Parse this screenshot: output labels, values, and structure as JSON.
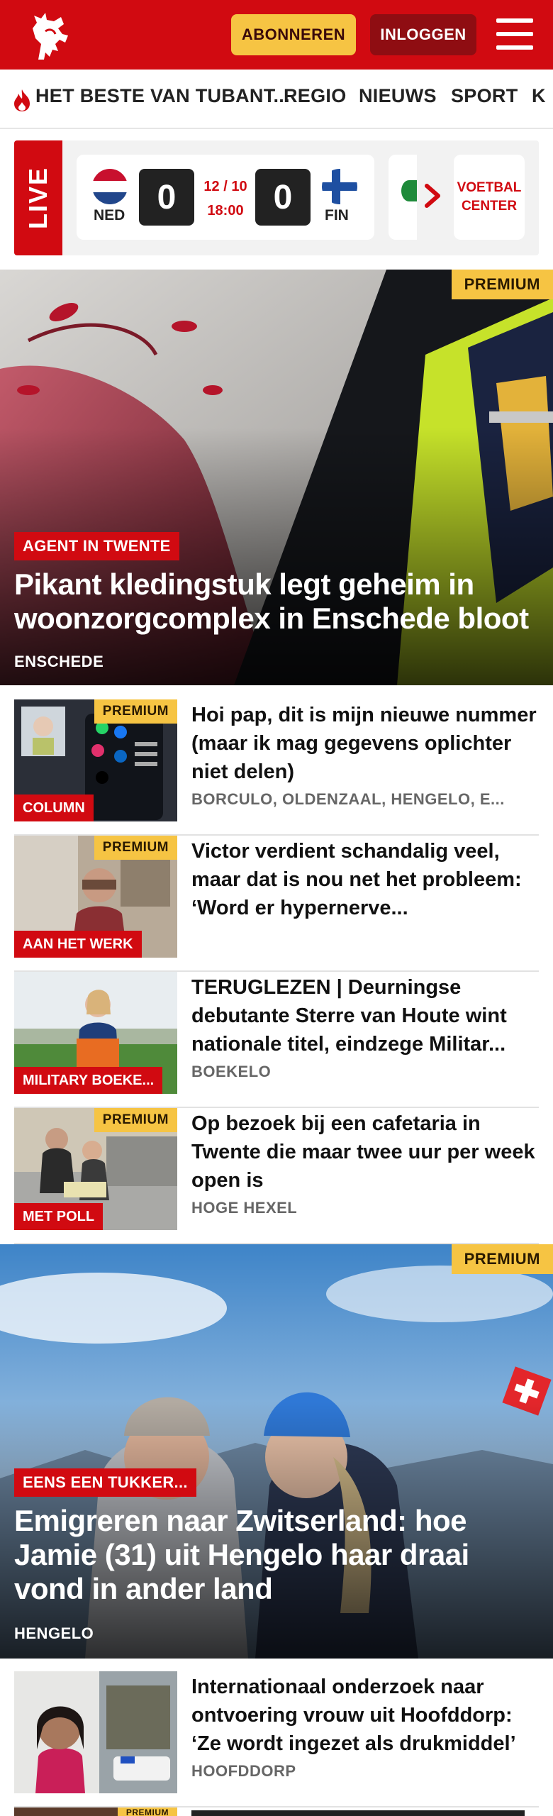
{
  "header": {
    "subscribe_label": "ABONNEREN",
    "login_label": "INLOGGEN",
    "logo_icon": "tubantia-horse-logo",
    "menu_icon": "hamburger-menu-icon",
    "brand_color": "#d10a11"
  },
  "nav": {
    "items": [
      "HET BESTE VAN TUBANT...",
      "REGIO",
      "NIEUWS",
      "SPORT",
      "K"
    ]
  },
  "live": {
    "label": "LIVE",
    "match": {
      "home": "NED",
      "away": "FIN",
      "home_score": "0",
      "away_score": "0",
      "date": "12 / 10",
      "time": "18:00"
    },
    "voetbal_center": "VOETBAL CENTER"
  },
  "hero1": {
    "premium": "PREMIUM",
    "kicker": "AGENT IN TWENTE",
    "title": "Pikant kledingstuk legt geheim in woonzorgcomplex in Enschede bloot",
    "location": "ENSCHEDE"
  },
  "articles": [
    {
      "premium": "PREMIUM",
      "kicker": "COLUMN",
      "title": "Hoi pap, dit is mijn nieuwe nummer (maar ik mag gegevens oplichter niet delen)",
      "location": "BORCULO, OLDENZAAL, HENGELO, E..."
    },
    {
      "premium": "PREMIUM",
      "kicker": "AAN HET WERK",
      "title": "Victor verdient schandalig veel, maar dat is nou net het probleem: ‘Word er hypernerve...",
      "location": ""
    },
    {
      "premium": "",
      "kicker": "MILITARY BOEKE...",
      "title": "TERUGLEZEN | Deurningse debutante Sterre van Houte wint nationale titel, eindzege Militar...",
      "location": "BOEKELO"
    },
    {
      "premium": "PREMIUM",
      "kicker": "MET POLL",
      "title": "Op bezoek bij een cafetaria in Twente die maar twee uur per week open is",
      "location": "HOGE HEXEL"
    }
  ],
  "hero2": {
    "premium": "PREMIUM",
    "kicker": "EENS EEN TUKKER...",
    "title": "Emigreren naar Zwitserland: hoe Jamie (31) uit Hengelo haar draai vond in ander land",
    "location": "HENGELO"
  },
  "articles2": [
    {
      "premium": "",
      "kicker": "",
      "title": "Internationaal onderzoek naar ontvoering vrouw uit Hoofddorp: ‘Ze wordt ingezet als drukmiddel’",
      "location": "HOOFDDORP"
    },
    {
      "premium": "PREMIUM",
      "kicker": "",
      "title": "",
      "location": ""
    }
  ]
}
